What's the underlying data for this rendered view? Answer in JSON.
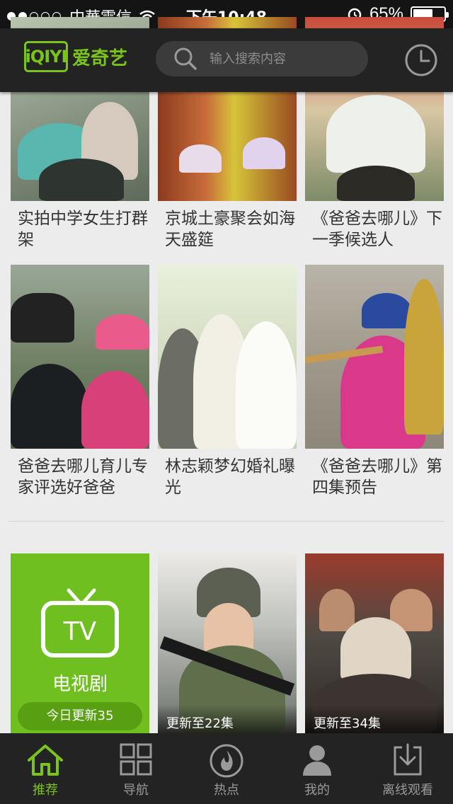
{
  "status_bar": {
    "carrier": "中華電信",
    "time": "下午10:48",
    "battery": "65%",
    "battery_level": 0.65
  },
  "header": {
    "logo_mark": "iQIYI",
    "logo_text": "爱奇艺",
    "search_placeholder": "输入搜索内容"
  },
  "grid_items": [
    {
      "caption": "实拍中学女生打群架"
    },
    {
      "caption": "京城土豪聚会如海天盛筵"
    },
    {
      "caption": "《爸爸去哪儿》下一季候选人"
    },
    {
      "caption": "爸爸去哪儿育儿专家评选好爸爸"
    },
    {
      "caption": "林志颖梦幻婚礼曝光"
    },
    {
      "caption": "《爸爸去哪儿》第四集预告"
    }
  ],
  "tv_tile": {
    "icon_text": "TV",
    "label": "电视剧",
    "update": "今日更新35"
  },
  "shows": [
    {
      "badge": "更新至22集"
    },
    {
      "badge": "更新至34集"
    }
  ],
  "tabs": [
    {
      "label": "推荐",
      "icon": "home-icon",
      "active": true
    },
    {
      "label": "导航",
      "icon": "grid-icon"
    },
    {
      "label": "热点",
      "icon": "flame-icon"
    },
    {
      "label": "我的",
      "icon": "user-icon"
    },
    {
      "label": "离线观看",
      "icon": "download-icon"
    }
  ],
  "colors": {
    "accent": "#7ac31c",
    "tv_tile": "#6ebf1f",
    "bar_bg": "#232323"
  }
}
